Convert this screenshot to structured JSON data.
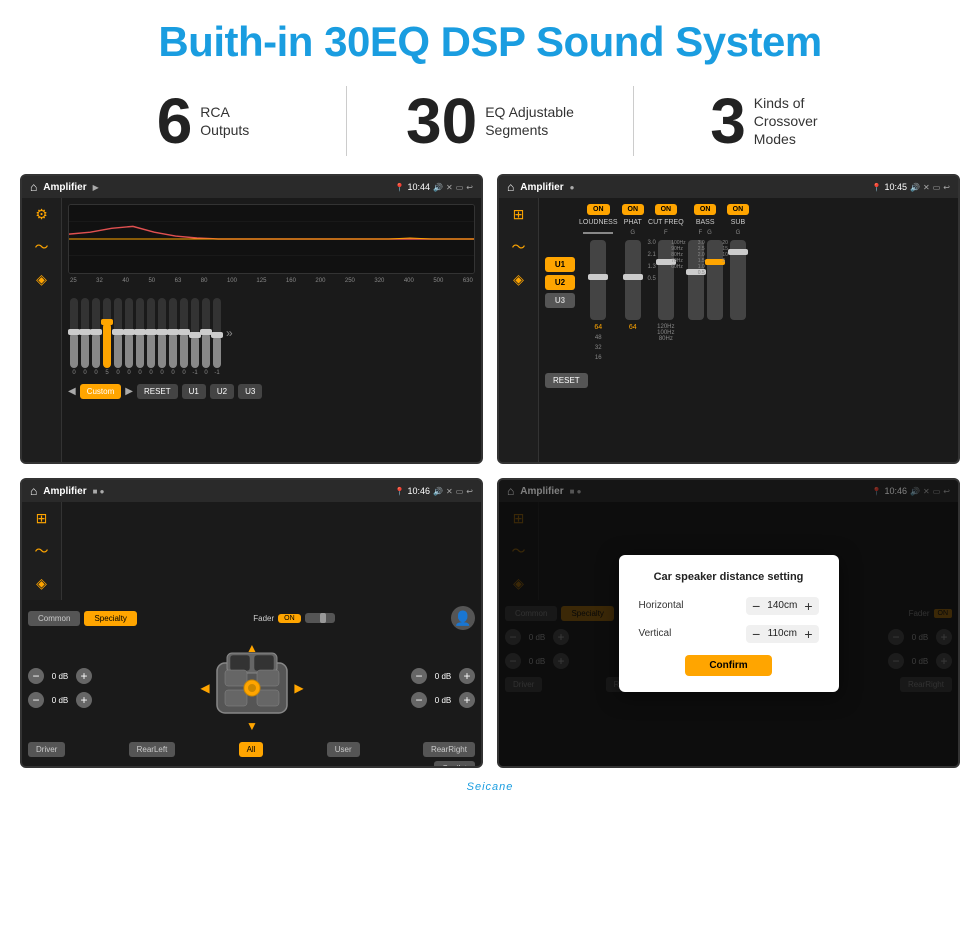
{
  "page": {
    "title": "Buith-in 30EQ DSP Sound System",
    "watermark": "Seicane"
  },
  "stats": [
    {
      "number": "6",
      "label": "RCA\nOutputs"
    },
    {
      "number": "30",
      "label": "EQ Adjustable\nSegments"
    },
    {
      "number": "3",
      "label": "Kinds of\nCrossover Modes"
    }
  ],
  "screens": {
    "eq": {
      "title": "Amplifier",
      "time": "10:44",
      "freq_labels": [
        "25",
        "32",
        "40",
        "50",
        "63",
        "80",
        "100",
        "125",
        "160",
        "200",
        "250",
        "320",
        "400",
        "500",
        "630"
      ],
      "sliders": [
        0,
        0,
        0,
        5,
        0,
        0,
        0,
        0,
        0,
        0,
        0,
        -1,
        0,
        -1
      ],
      "controls": [
        "Custom",
        "RESET",
        "U1",
        "U2",
        "U3"
      ]
    },
    "amp": {
      "title": "Amplifier",
      "time": "10:45",
      "channels": [
        "U1",
        "U2",
        "U3"
      ],
      "toggles": [
        "LOUDNESS",
        "PHAT",
        "CUT FREQ",
        "BASS",
        "SUB"
      ],
      "reset_label": "RESET"
    },
    "speaker": {
      "title": "Amplifier",
      "time": "10:46",
      "tabs": [
        "Common",
        "Specialty"
      ],
      "fader": "Fader",
      "fader_on": "ON",
      "db_values": [
        "0 dB",
        "0 dB",
        "0 dB",
        "0 dB"
      ],
      "position_btns": [
        "Driver",
        "RearLeft",
        "Copilot",
        "RearRight"
      ],
      "all_btn": "All",
      "user_btn": "User"
    },
    "dialog": {
      "title": "Amplifier",
      "time": "10:46",
      "dialog_title": "Car speaker distance setting",
      "horizontal_label": "Horizontal",
      "horizontal_value": "140cm",
      "vertical_label": "Vertical",
      "vertical_value": "110cm",
      "confirm_label": "Confirm",
      "db_values": [
        "0 dB",
        "0 dB"
      ],
      "position_btns": [
        "Driver",
        "RearLeft",
        "Copilot",
        "RearRight"
      ]
    }
  }
}
